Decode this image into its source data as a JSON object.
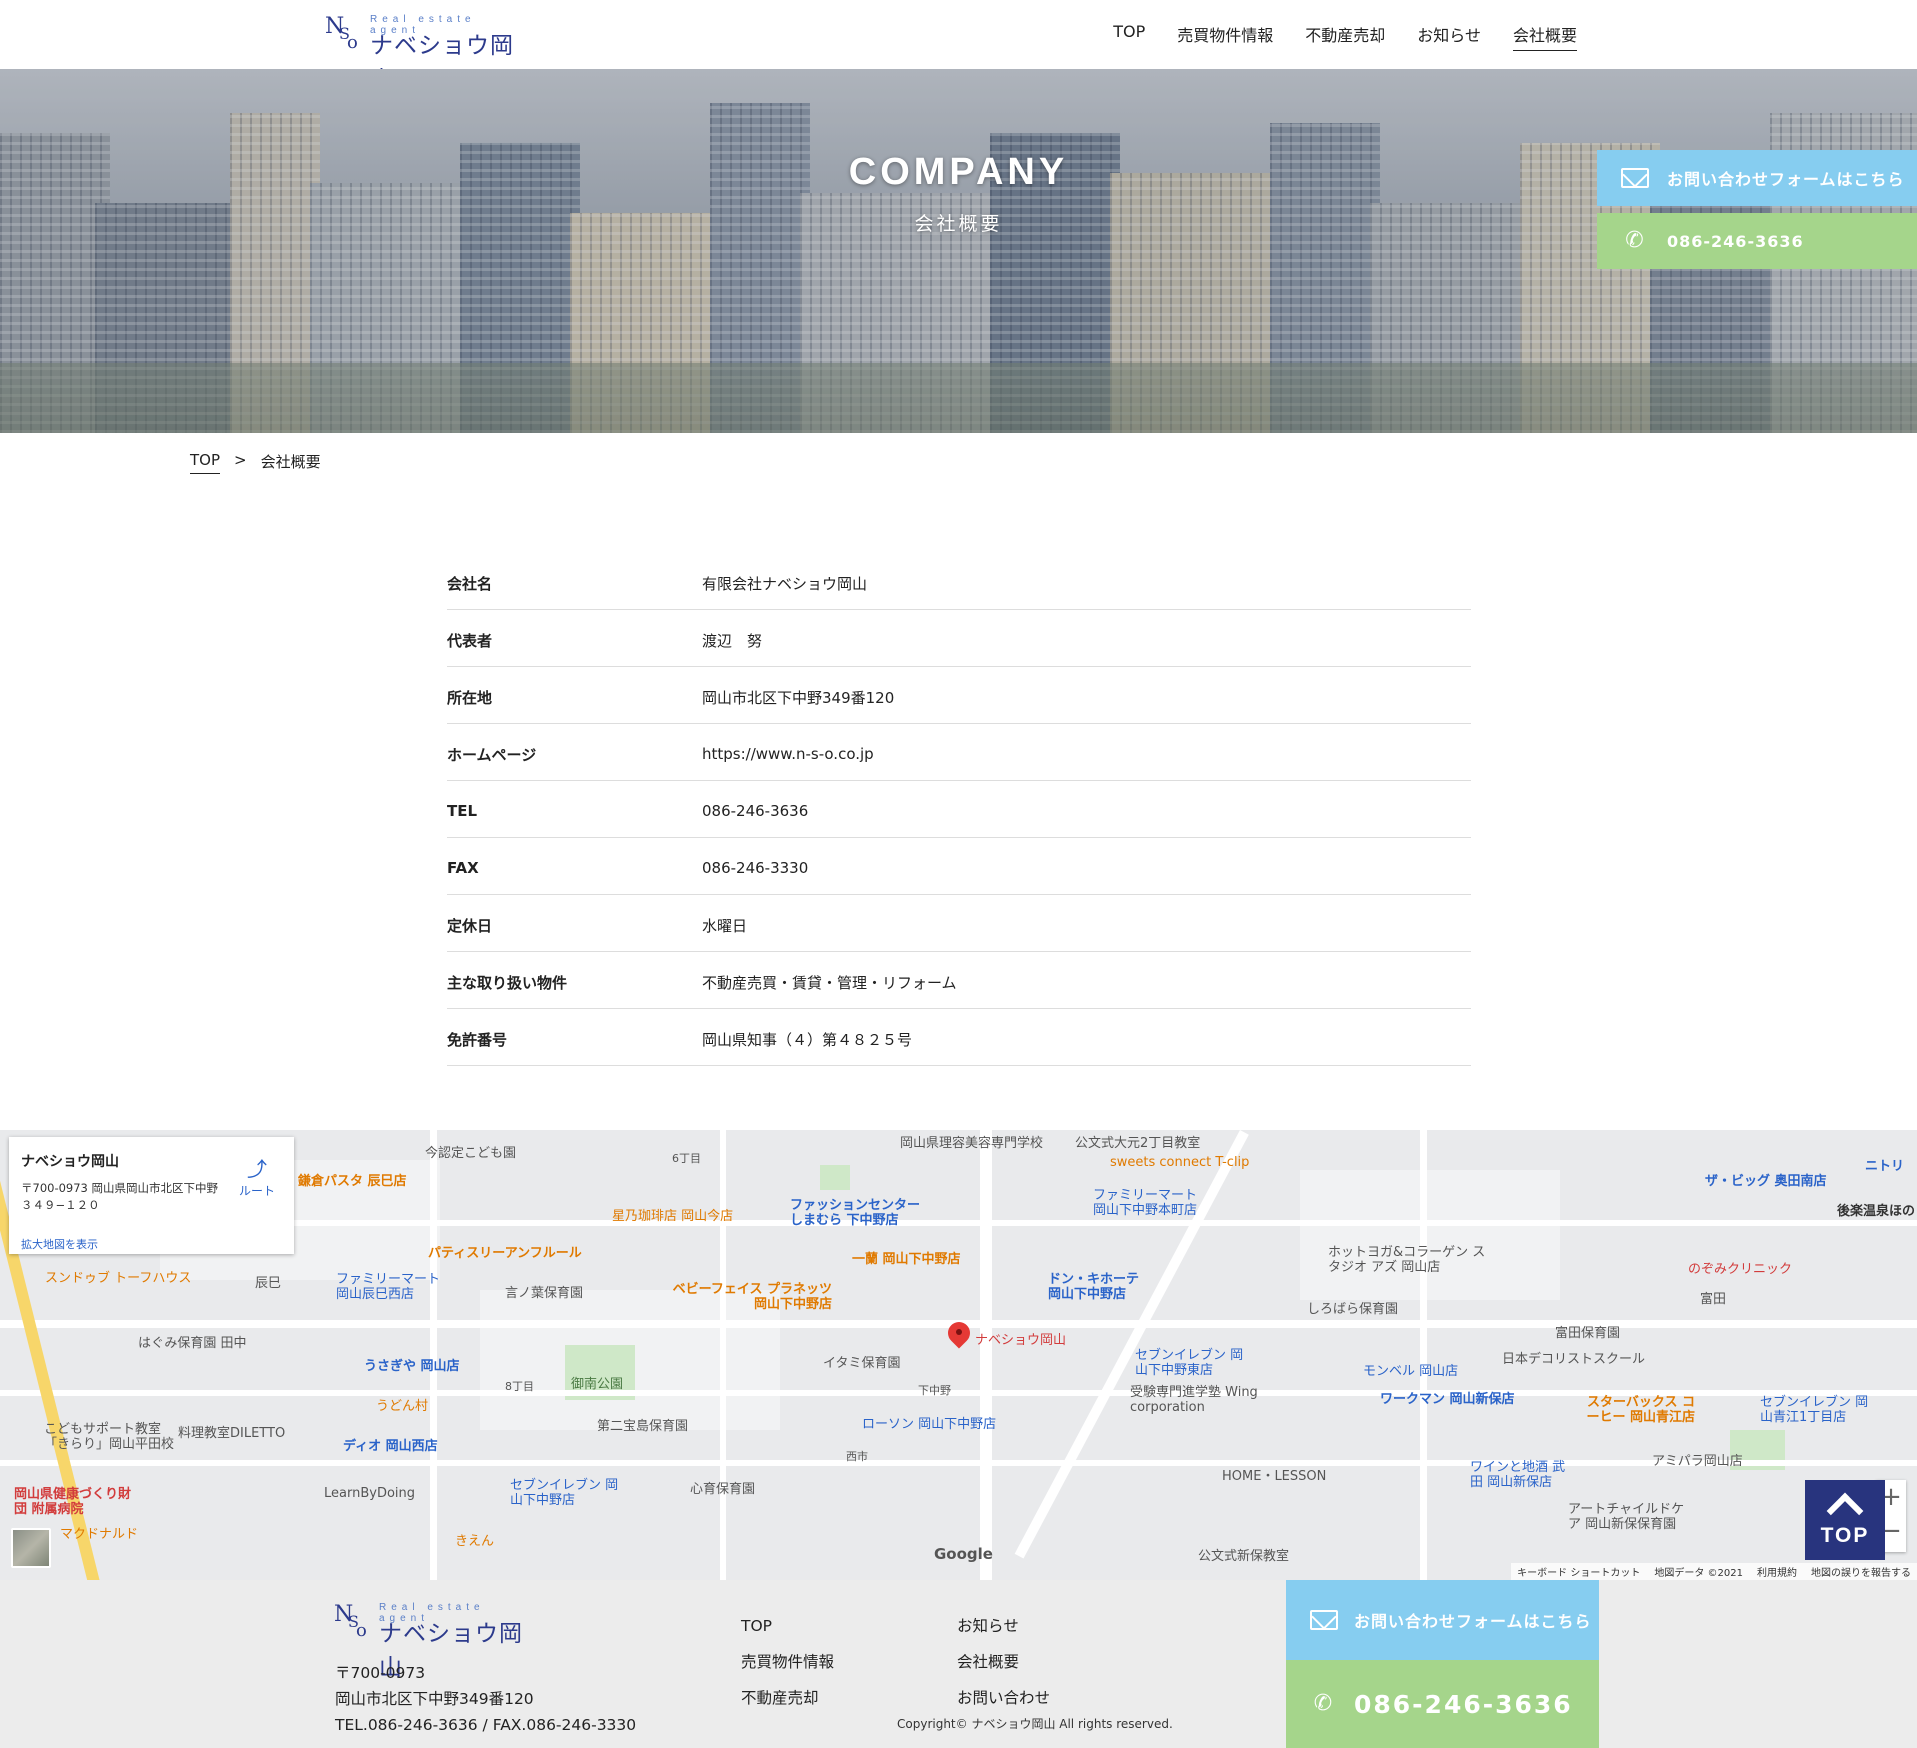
{
  "header": {
    "logo": {
      "tagline": "Real estate agent",
      "name": "ナベショウ岡山"
    },
    "nav": [
      {
        "label": "TOP"
      },
      {
        "label": "売買物件情報"
      },
      {
        "label": "不動産売却"
      },
      {
        "label": "お知らせ"
      },
      {
        "label": "会社概要",
        "active": true
      }
    ]
  },
  "hero": {
    "title": "COMPANY",
    "subtitle": "会社概要"
  },
  "float_cta": {
    "mail_label": "お問い合わせフォームはこちら",
    "tel_label": "086-246-3636"
  },
  "breadcrumb": {
    "home": "TOP",
    "separator": ">",
    "current": "会社概要"
  },
  "company": {
    "rows": [
      {
        "label": "会社名",
        "value": "有限会社ナベショウ岡山"
      },
      {
        "label": "代表者",
        "value": "渡辺　努"
      },
      {
        "label": "所在地",
        "value": "岡山市北区下中野349番120"
      },
      {
        "label": "ホームページ",
        "value": "https://www.n-s-o.co.jp"
      },
      {
        "label": "TEL",
        "value": "086-246-3636"
      },
      {
        "label": "FAX",
        "value": "086-246-3330"
      },
      {
        "label": "定休日",
        "value": "水曜日"
      },
      {
        "label": "主な取り扱い物件",
        "value": "不動産売買・賃貸・管理・リフォーム"
      },
      {
        "label": "免許番号",
        "value": "岡山県知事（４）第４８２５号"
      }
    ]
  },
  "map": {
    "card": {
      "title": "ナベショウ岡山",
      "address": "〒700-0973 岡山県岡山市北区下中野３４９−１２０",
      "route": "ルート",
      "enlarge": "拡大地図を表示"
    },
    "marker_label": "ナベショウ岡山",
    "pois": [
      "今認定こども園",
      "岡山県理容美容専門学校",
      "公文式大元2丁目教室",
      "sweets connect T-clip",
      "鎌倉パスタ 辰巳店",
      "星乃珈琲店 岡山今店",
      "ファッションセンター しまむら 下中野店",
      "ファミリーマート 岡山下中野本町店",
      "ザ・ビッグ 奥田南店",
      "後楽温泉ほの",
      "パティスリーアンフルール",
      "一蘭 岡山下中野店",
      "ドン・キホーテ 岡山下中野店",
      "ホットヨガ&コラーゲン スタジオ アズ 岡山店",
      "のぞみクリニック",
      "スンドゥブ トーフハウス",
      "ファミリーマート 岡山辰巳西店",
      "言ノ葉保育園",
      "ベビーフェイス プラネッツ 岡山下中野店",
      "しろばら保育園",
      "富田保育園",
      "はぐみ保育園 田中",
      "うさぎや 岡山店",
      "イタミ保育園",
      "セブンイレブン 岡山下中野東店",
      "モンベル 岡山店",
      "日本デコリストスクール",
      "うどん村",
      "御南公園",
      "受験専門進学塾 Wing corporation",
      "ワークマン 岡山新保店",
      "スターバックス コーヒー 岡山青江店",
      "セブンイレブン 岡山青江1丁目店",
      "こどもサポート教室「きらり」岡山平田校",
      "料理教室DILETTO",
      "第二宝島保育園",
      "ローソン 岡山下中野店",
      "ディオ 岡山西店",
      "アミパラ岡山店",
      "岡山県健康づくり財団 附属病院",
      "LearnByDoing",
      "セブンイレブン 岡山下中野店",
      "心育保育園",
      "HOME・LESSON",
      "ワインと地酒 武田 岡山新保店",
      "アートチャイルドケア 岡山新保保育園",
      "マクドナルド",
      "きえん",
      "公文式新保教室",
      "ニトリ",
      "富田",
      "辰巳",
      "6丁目",
      "8丁目",
      "下中野",
      "西市"
    ],
    "footer_links": [
      "キーボード ショートカット",
      "地図データ ©2021",
      "利用規約",
      "地図の誤りを報告する"
    ],
    "google": "Google"
  },
  "top_button": "TOP",
  "footer": {
    "logo": {
      "tagline": "Real estate agent",
      "name": "ナベショウ岡山"
    },
    "postal": "〒700-0973",
    "address": "岡山市北区下中野349番120",
    "tel_fax": "TEL.086-246-3636 / FAX.086-246-3330",
    "nav_col1": [
      "TOP",
      "売買物件情報",
      "不動産売却"
    ],
    "nav_col2": [
      "お知らせ",
      "会社概要",
      "お問い合わせ"
    ],
    "copyright": "Copyright© ナベショウ岡山 All rights reserved.",
    "cta_mail": "お問い合わせフォームはこちら",
    "cta_tel": "086-246-3636"
  },
  "colors": {
    "brand_navy": "#28347e",
    "cta_blue": "#86cdf0",
    "cta_green": "#a5d58b",
    "footer_bg": "#ececec"
  }
}
